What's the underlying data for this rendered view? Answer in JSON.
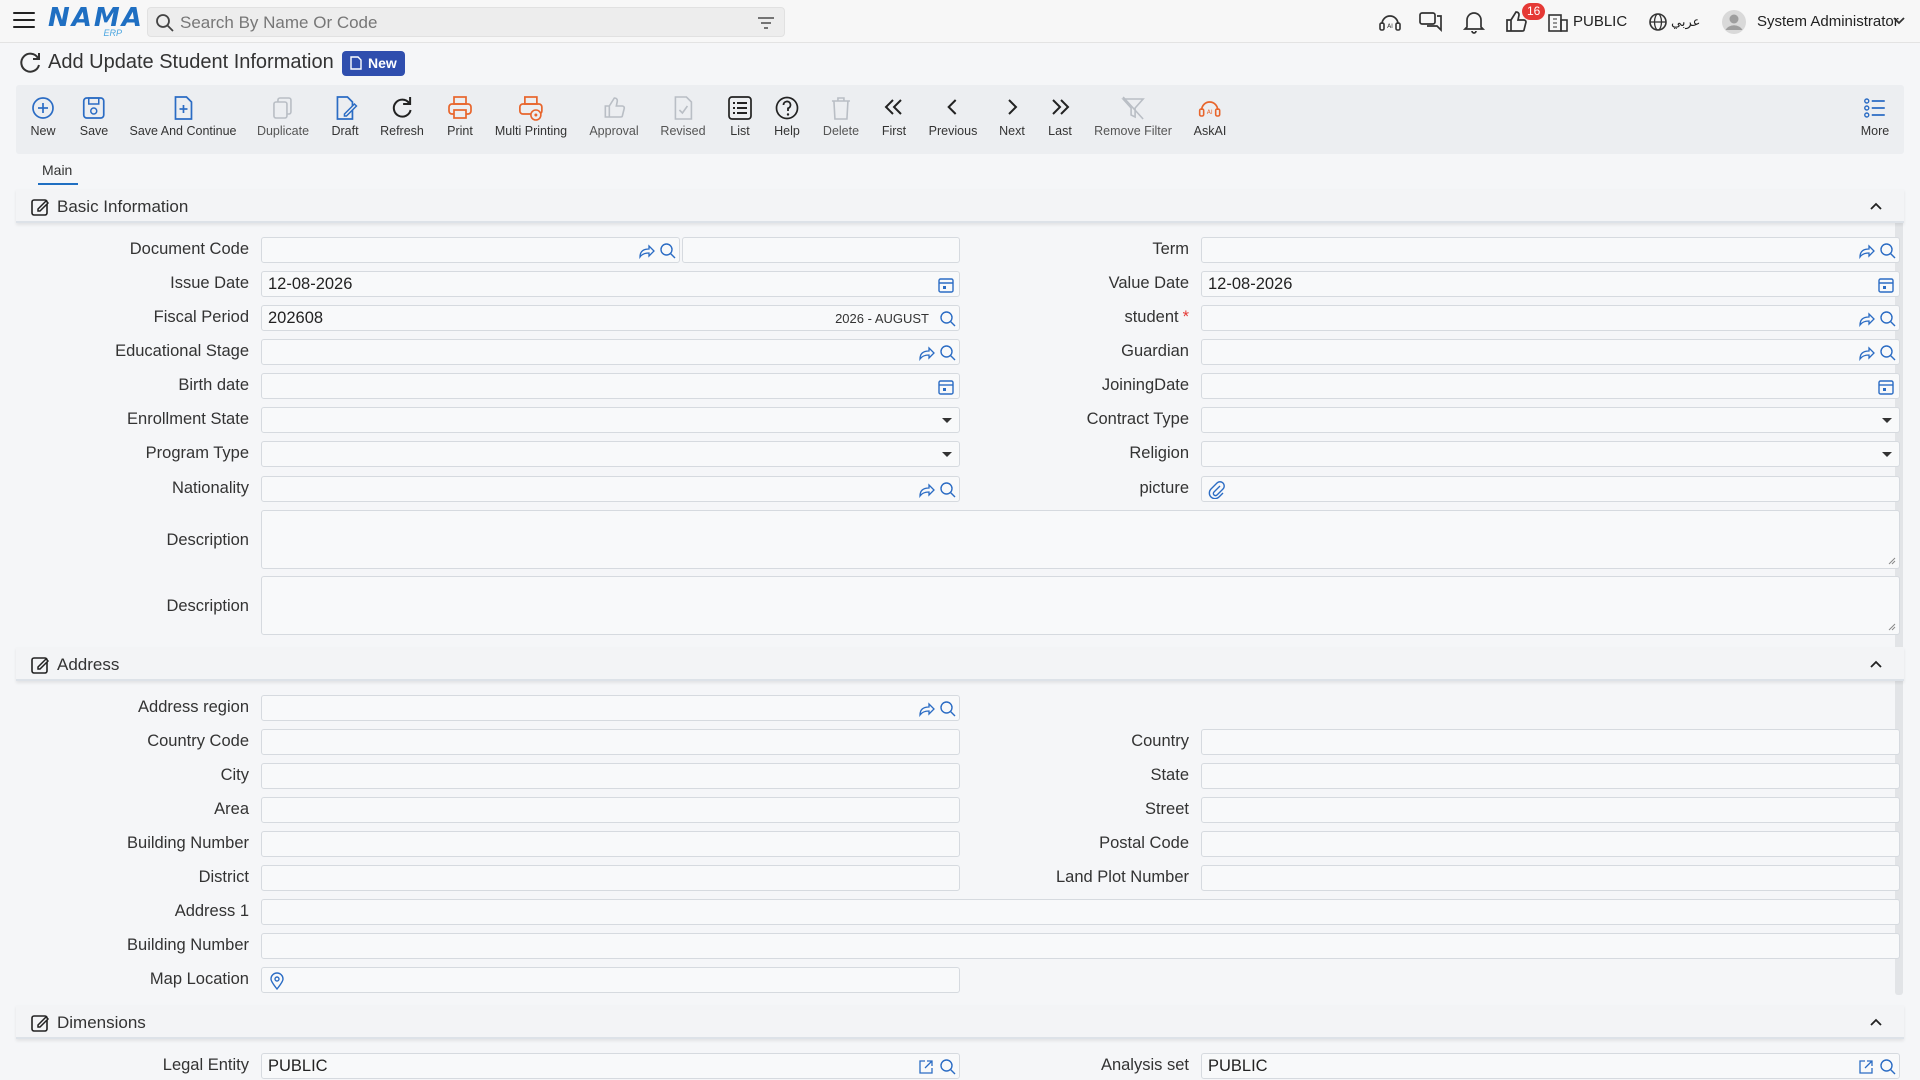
{
  "topbar": {
    "logo_text": "NAMA",
    "logo_sub": "ERP",
    "search_placeholder": "Search By Name Or Code",
    "notification_count": "16",
    "company": "PUBLIC",
    "language": "عربي",
    "user": "System Administrator"
  },
  "page": {
    "title": "Add Update Student Information",
    "status_badge": "New"
  },
  "toolbar": {
    "new": "New",
    "save": "Save",
    "save_continue": "Save And Continue",
    "duplicate": "Duplicate",
    "draft": "Draft",
    "refresh": "Refresh",
    "print": "Print",
    "multi_printing": "Multi Printing",
    "approval": "Approval",
    "revised": "Revised",
    "list": "List",
    "help": "Help",
    "delete": "Delete",
    "first": "First",
    "previous": "Previous",
    "next": "Next",
    "last": "Last",
    "remove_filter": "Remove Filter",
    "askai": "AskAI",
    "more": "More"
  },
  "tabs": {
    "main": "Main"
  },
  "basic": {
    "title": "Basic Information",
    "document_code_label": "Document Code",
    "document_code_value": "",
    "term_label": "Term",
    "term_value": "",
    "issue_date_label": "Issue Date",
    "issue_date_value": "12-08-2026",
    "value_date_label": "Value Date",
    "value_date_value": "12-08-2026",
    "fiscal_period_label": "Fiscal Period",
    "fiscal_period_value": "202608",
    "fiscal_period_name": "2026 - AUGUST",
    "student_label": "student",
    "student_required": "*",
    "educational_stage_label": "Educational Stage",
    "guardian_label": "Guardian",
    "birth_date_label": "Birth date",
    "joining_date_label": "JoiningDate",
    "enrollment_state_label": "Enrollment State",
    "contract_type_label": "Contract Type",
    "program_type_label": "Program Type",
    "religion_label": "Religion",
    "nationality_label": "Nationality",
    "picture_label": "picture",
    "description1_label": "Description",
    "description2_label": "Description"
  },
  "address": {
    "title": "Address",
    "region_label": "Address region",
    "country_code_label": "Country Code",
    "country_label": "Country",
    "city_label": "City",
    "state_label": "State",
    "area_label": "Area",
    "street_label": "Street",
    "building_number_label": "Building Number",
    "postal_code_label": "Postal Code",
    "district_label": "District",
    "land_plot_label": "Land Plot Number",
    "address1_label": "Address 1",
    "building_number2_label": "Building Number",
    "map_location_label": "Map Location"
  },
  "dimensions": {
    "title": "Dimensions",
    "legal_entity_label": "Legal Entity",
    "legal_entity_value": "PUBLIC",
    "analysis_set_label": "Analysis set",
    "analysis_set_value": "PUBLIC"
  },
  "colors": {
    "brand": "#1f6fc2",
    "accent_blue": "#2f4eae",
    "print_orange": "#e8652c",
    "badge_red": "#e53935"
  }
}
